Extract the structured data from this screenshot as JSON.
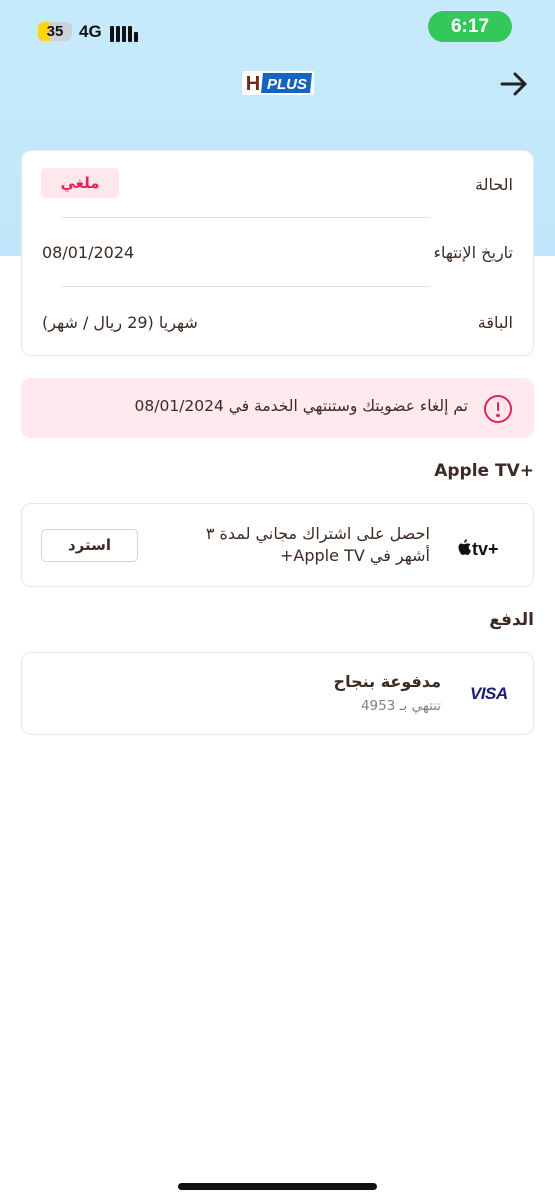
{
  "status_bar": {
    "battery": "35",
    "battery_level": 0.35,
    "network": "4G",
    "time": "6:17"
  },
  "header": {
    "logo_letter": "H",
    "logo_word": "PLUS",
    "back_icon": "arrow-right-icon"
  },
  "subscription": {
    "status_label": "الحالة",
    "status_value": "ملغي",
    "end_date_label": "تاريخ الإنتهاء",
    "end_date_value": "08/01/2024",
    "plan_label": "الباقة",
    "plan_value": "شهريا (29 ريال / شهر)"
  },
  "alert": {
    "icon": "exclamation-circle-icon",
    "text": "تم إلغاء عضويتك وستنتهي الخدمة في 08/01/2024"
  },
  "apple_tv": {
    "section_title": "Apple TV+",
    "logo_text": "tv+",
    "promo_line1": "احصل على اشتراك مجاني لمدة ٣",
    "promo_line2": "أشهر في Apple TV+",
    "redeem_label": "استرد"
  },
  "payment": {
    "section_title": "الدفع",
    "card_brand": "VISA",
    "status": "مدفوعة بنجاح",
    "card_info": "تنتهي بـ 4953"
  },
  "colors": {
    "header_bg": "#c7ebfc",
    "accent_red": "#e0245e",
    "time_green": "#34c759",
    "visa_blue": "#1a1f71",
    "text_brown": "#3d2b23"
  }
}
